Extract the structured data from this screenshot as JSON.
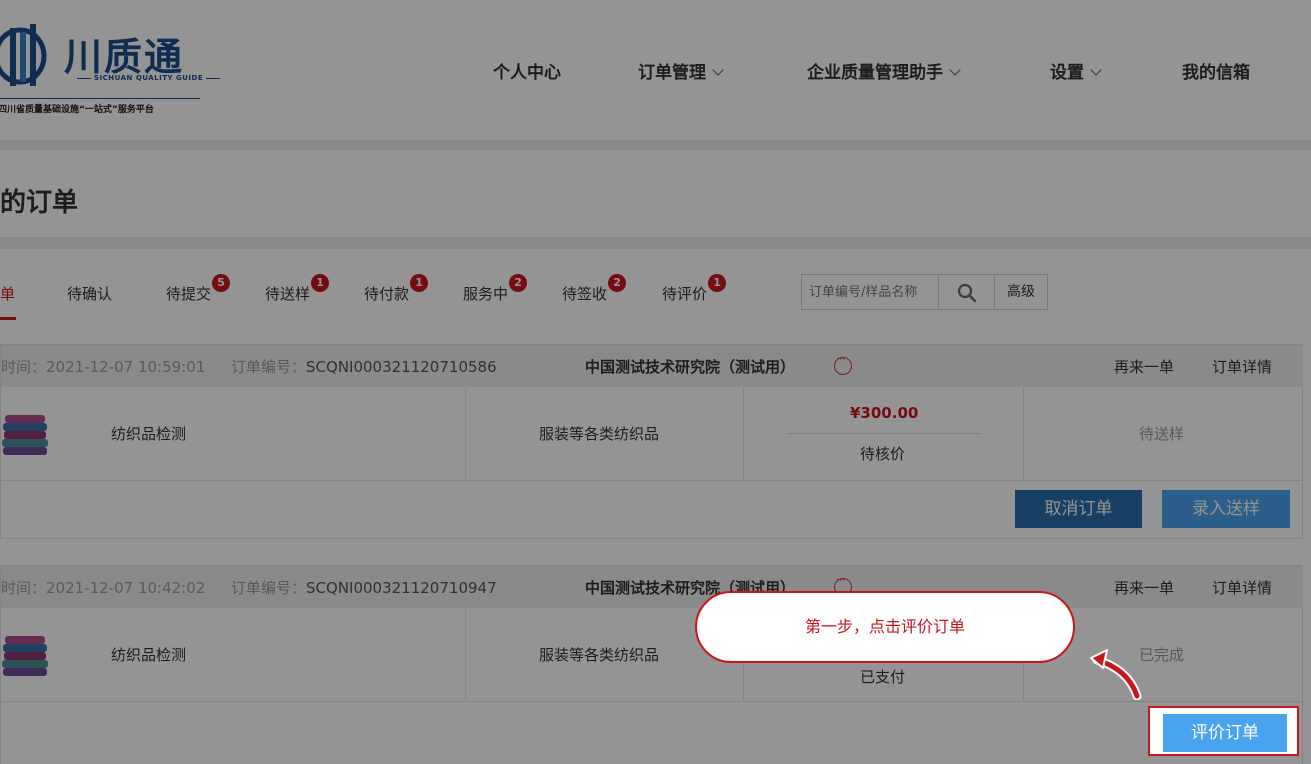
{
  "brand": {
    "title": "川质通",
    "subtitle": "SICHUAN QUALITY GUIDE",
    "slogan": "四川省质量基础设施“一站式”服务平台"
  },
  "nav": [
    {
      "label": "个人中心",
      "has_dropdown": false
    },
    {
      "label": "订单管理",
      "has_dropdown": true
    },
    {
      "label": "企业质量管理助手",
      "has_dropdown": true
    },
    {
      "label": "设置",
      "has_dropdown": true
    },
    {
      "label": "我的信箱",
      "has_dropdown": false
    }
  ],
  "page_title": "的订单",
  "tabs": [
    {
      "label": "单",
      "active": true
    },
    {
      "label": "待确认",
      "badge": ""
    },
    {
      "label": "待提交",
      "badge": "5"
    },
    {
      "label": "待送样",
      "badge": "1"
    },
    {
      "label": "待付款",
      "badge": "1"
    },
    {
      "label": "服务中",
      "badge": "2"
    },
    {
      "label": "待签收",
      "badge": "2"
    },
    {
      "label": "待评价",
      "badge": "1"
    }
  ],
  "search": {
    "placeholder": "订单编号/样品名称",
    "advanced_label": "高级"
  },
  "orders": [
    {
      "time_label": "时间：",
      "time": "2021-12-07 10:59:01",
      "no_label": "订单编号：",
      "order_no": "SCQNI000321120710586",
      "institution": "中国测试技术研究院（测试用）",
      "reorder": "再来一单",
      "detail": "订单详情",
      "item_name": "纺织品检测",
      "category": "服装等各类纺织品",
      "price": "¥300.00",
      "price_status": "待核价",
      "status": "待送样",
      "actions": [
        "取消订单",
        "录入送样"
      ]
    },
    {
      "time_label": "时间：",
      "time": "2021-12-07 10:42:02",
      "no_label": "订单编号：",
      "order_no": "SCQNI000321120710947",
      "institution": "中国测试技术研究院（测试用）",
      "reorder": "再来一单",
      "detail": "订单详情",
      "item_name": "纺织品检测",
      "category": "服装等各类纺织品",
      "price_status": "已支付",
      "status": "已完成",
      "actions": [
        "评价订单"
      ]
    }
  ],
  "guide": {
    "callout": "第一步，点击评价订单"
  },
  "colors": {
    "brand": "#1b4f8a",
    "accent_red": "#c8161d",
    "btn_dark": "#2a6eb0",
    "btn_light": "#4aa3ef"
  }
}
